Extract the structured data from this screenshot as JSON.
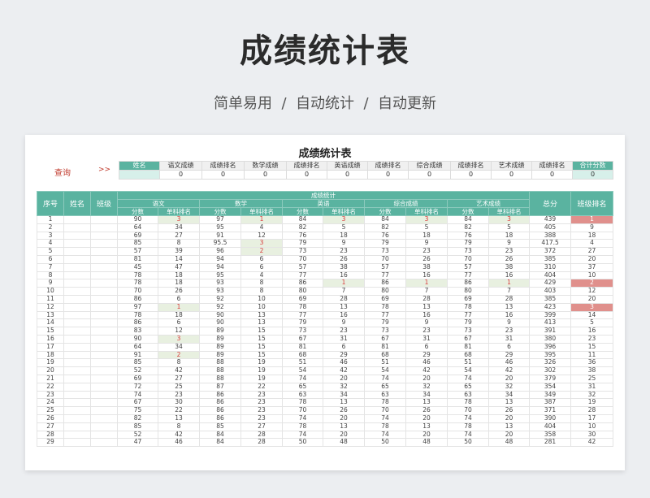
{
  "page": {
    "title": "成绩统计表",
    "subtitle": "简单易用  /  自动统计  /  自动更新"
  },
  "sheet": {
    "title": "成绩统计表",
    "query_label": "查询",
    "query_arrow": ">>",
    "query_headers": [
      "姓名",
      "语文成绩",
      "成绩排名",
      "数学成绩",
      "成绩排名",
      "英语成绩",
      "成绩排名",
      "综合成绩",
      "成绩排名",
      "艺术成绩",
      "成绩排名",
      "合计分数"
    ],
    "query_values": [
      "",
      "0",
      "0",
      "0",
      "0",
      "0",
      "0",
      "0",
      "0",
      "0",
      "0",
      "0"
    ],
    "headers": {
      "seq": "序号",
      "name": "姓名",
      "class": "班级",
      "group": "成绩统计",
      "subjects": [
        "语文",
        "数学",
        "英语",
        "综合成绩",
        "艺术成绩"
      ],
      "score": "分数",
      "rank": "单科排名",
      "total": "总分",
      "class_rank": "班级排名"
    },
    "rows": [
      [
        1,
        "",
        "",
        90,
        3,
        97,
        1,
        84,
        3,
        84,
        3,
        84,
        3,
        439,
        1
      ],
      [
        2,
        "",
        "",
        64,
        34,
        95,
        4,
        82,
        5,
        82,
        5,
        82,
        5,
        405,
        9
      ],
      [
        3,
        "",
        "",
        69,
        27,
        91,
        12,
        76,
        18,
        76,
        18,
        76,
        18,
        388,
        18
      ],
      [
        4,
        "",
        "",
        85,
        8,
        95.5,
        3,
        79,
        9,
        79,
        9,
        79,
        9,
        417.5,
        4
      ],
      [
        5,
        "",
        "",
        57,
        39,
        96,
        2,
        73,
        23,
        73,
        23,
        73,
        23,
        372,
        27
      ],
      [
        6,
        "",
        "",
        81,
        14,
        94,
        6,
        70,
        26,
        70,
        26,
        70,
        26,
        385,
        20
      ],
      [
        7,
        "",
        "",
        45,
        47,
        94,
        6,
        57,
        38,
        57,
        38,
        57,
        38,
        310,
        37
      ],
      [
        8,
        "",
        "",
        78,
        18,
        95,
        4,
        77,
        16,
        77,
        16,
        77,
        16,
        404,
        10
      ],
      [
        9,
        "",
        "",
        78,
        18,
        93,
        8,
        86,
        1,
        86,
        1,
        86,
        1,
        429,
        2
      ],
      [
        10,
        "",
        "",
        70,
        26,
        93,
        8,
        80,
        7,
        80,
        7,
        80,
        7,
        403,
        12
      ],
      [
        11,
        "",
        "",
        86,
        6,
        92,
        10,
        69,
        28,
        69,
        28,
        69,
        28,
        385,
        20
      ],
      [
        12,
        "",
        "",
        97,
        1,
        92,
        10,
        78,
        13,
        78,
        13,
        78,
        13,
        423,
        3
      ],
      [
        13,
        "",
        "",
        78,
        18,
        90,
        13,
        77,
        16,
        77,
        16,
        77,
        16,
        399,
        14
      ],
      [
        14,
        "",
        "",
        86,
        6,
        90,
        13,
        79,
        9,
        79,
        9,
        79,
        9,
        413,
        5
      ],
      [
        15,
        "",
        "",
        83,
        12,
        89,
        15,
        73,
        23,
        73,
        23,
        73,
        23,
        391,
        16
      ],
      [
        16,
        "",
        "",
        90,
        3,
        89,
        15,
        67,
        31,
        67,
        31,
        67,
        31,
        380,
        23
      ],
      [
        17,
        "",
        "",
        64,
        34,
        89,
        15,
        81,
        6,
        81,
        6,
        81,
        6,
        396,
        15
      ],
      [
        18,
        "",
        "",
        91,
        2,
        89,
        15,
        68,
        29,
        68,
        29,
        68,
        29,
        395,
        11
      ],
      [
        19,
        "",
        "",
        85,
        8,
        88,
        19,
        51,
        46,
        51,
        46,
        51,
        46,
        326,
        36
      ],
      [
        20,
        "",
        "",
        52,
        42,
        88,
        19,
        54,
        42,
        54,
        42,
        54,
        42,
        302,
        38
      ],
      [
        21,
        "",
        "",
        69,
        27,
        88,
        19,
        74,
        20,
        74,
        20,
        74,
        20,
        379,
        25
      ],
      [
        22,
        "",
        "",
        72,
        25,
        87,
        22,
        65,
        32,
        65,
        32,
        65,
        32,
        354,
        31
      ],
      [
        23,
        "",
        "",
        74,
        23,
        86,
        23,
        63,
        34,
        63,
        34,
        63,
        34,
        349,
        32
      ],
      [
        24,
        "",
        "",
        67,
        30,
        86,
        23,
        78,
        13,
        78,
        13,
        78,
        13,
        387,
        19
      ],
      [
        25,
        "",
        "",
        75,
        22,
        86,
        23,
        70,
        26,
        70,
        26,
        70,
        26,
        371,
        28
      ],
      [
        26,
        "",
        "",
        82,
        13,
        86,
        23,
        74,
        20,
        74,
        20,
        74,
        20,
        390,
        17
      ],
      [
        27,
        "",
        "",
        85,
        8,
        85,
        27,
        78,
        13,
        78,
        13,
        78,
        13,
        404,
        10
      ],
      [
        28,
        "",
        "",
        52,
        42,
        84,
        28,
        74,
        20,
        74,
        20,
        74,
        20,
        358,
        30
      ],
      [
        29,
        "",
        "",
        47,
        46,
        84,
        28,
        50,
        48,
        50,
        48,
        50,
        48,
        281,
        42
      ]
    ]
  },
  "colors": {
    "header_teal": "#5ab3a0",
    "rank_highlight_bg": "#e8f0e0",
    "rank_highlight_text": "#d93a3a",
    "class_rank_highlight": "#e0908c",
    "query_text": "#c0392b"
  }
}
